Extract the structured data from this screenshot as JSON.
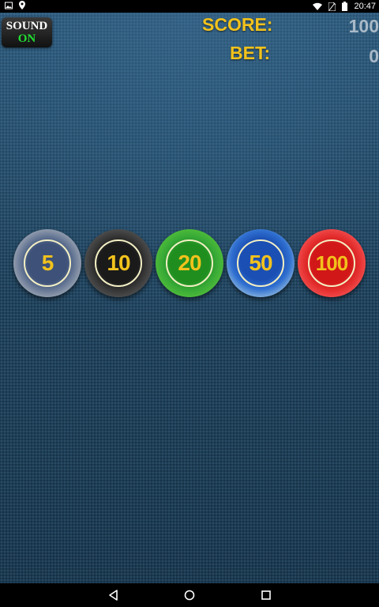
{
  "status_bar": {
    "time": "20:47",
    "icons": [
      "image-icon",
      "location-icon",
      "wifi-icon",
      "no-sim-icon",
      "battery-icon"
    ]
  },
  "sound_toggle": {
    "label": "SOUND",
    "state": "ON",
    "state_color": "#22e033"
  },
  "hud": {
    "score_label": "SCORE:",
    "score_value": "100",
    "bet_label": "BET:",
    "bet_value": "0",
    "label_color": "#f2c21c"
  },
  "chips": [
    {
      "value": "5",
      "color": "#3d5179"
    },
    {
      "value": "10",
      "color": "#1a1a1a"
    },
    {
      "value": "20",
      "color": "#1f8e1f"
    },
    {
      "value": "50",
      "color": "#1b4fb4"
    },
    {
      "value": "100",
      "color": "#d11717"
    }
  ],
  "nav_bar": {
    "icons": [
      "back-icon",
      "home-icon",
      "recents-icon"
    ]
  }
}
